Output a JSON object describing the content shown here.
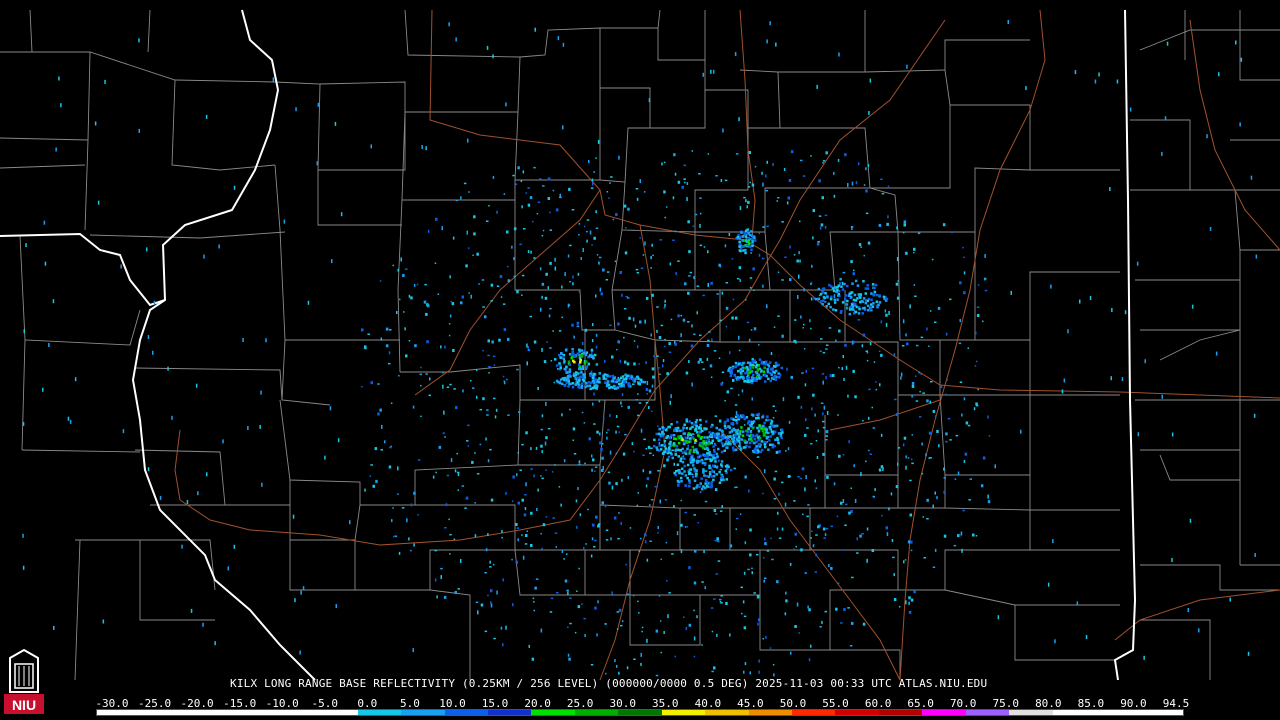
{
  "caption": "KILX LONG RANGE BASE REFLECTIVITY (0.25KM / 256 LEVEL) (000000/0000 0.5 DEG) 2025-11-03 00:33 UTC  ATLAS.NIU.EDU",
  "scale": {
    "ticks": [
      "-30.0",
      "-25.0",
      "-20.0",
      "-15.0",
      "-10.0",
      "-5.0",
      "0.0",
      "5.0",
      "10.0",
      "15.0",
      "20.0",
      "25.0",
      "30.0",
      "35.0",
      "40.0",
      "45.0",
      "50.0",
      "55.0",
      "60.0",
      "65.0",
      "70.0",
      "75.0",
      "80.0",
      "85.0",
      "90.0",
      "94.5"
    ],
    "colors": [
      "#ffffff",
      "#ffffff",
      "#ffffff",
      "#ffffff",
      "#ffffff",
      "#ffffff",
      "#16c7e6",
      "#1aa0f2",
      "#0b5fe8",
      "#1230cc",
      "#00e000",
      "#00b000",
      "#007800",
      "#f0f000",
      "#f0c000",
      "#f08c00",
      "#ff2a00",
      "#d00000",
      "#b00000",
      "#ff00ff",
      "#a060ff",
      "#e0e0e0",
      "#ffffff",
      "#ffffff",
      "#ffffff"
    ]
  },
  "logo": {
    "text": "NIU",
    "color": "#c8102e"
  },
  "map": {
    "background": "#000000",
    "county_line_color": "#8a8a8a",
    "state_line_color": "#ffffff",
    "highway_color": "#a0522d"
  }
}
